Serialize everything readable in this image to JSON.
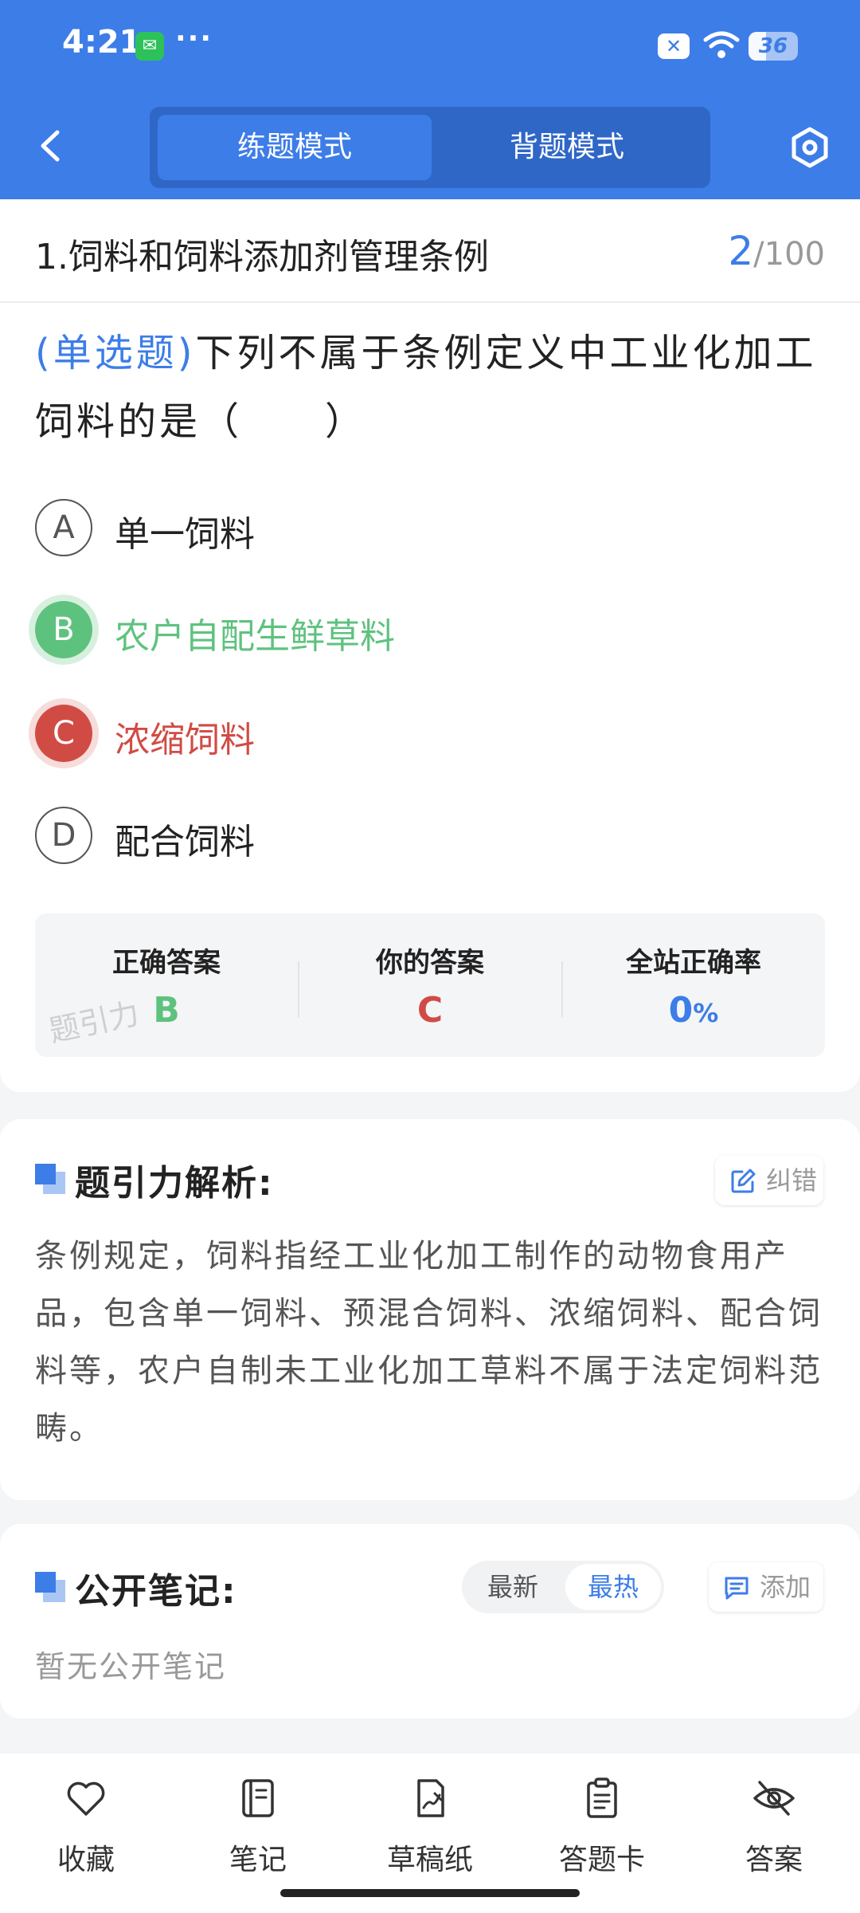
{
  "status_bar": {
    "time": "4:21",
    "dots": "···",
    "battery": "36",
    "battery_level": 0.36
  },
  "header": {
    "tabs": [
      {
        "label": "练题模式",
        "active": true
      },
      {
        "label": "背题模式",
        "active": false
      }
    ],
    "accent_color": "#3d7de8"
  },
  "question": {
    "chapter": "1.饲料和饲料添加剂管理条例",
    "current": "2",
    "total": "/100",
    "type": "(单选题)",
    "text": "下列不属于条例定义中工业化加工饲料的是（　　）",
    "options": [
      {
        "letter": "A",
        "text": "单一饲料",
        "state": "normal"
      },
      {
        "letter": "B",
        "text": "农户自配生鲜草料",
        "state": "correct"
      },
      {
        "letter": "C",
        "text": "浓缩饲料",
        "state": "wrong"
      },
      {
        "letter": "D",
        "text": "配合饲料",
        "state": "normal"
      }
    ]
  },
  "answer_summary": {
    "correct_label": "正确答案",
    "correct_value": "B",
    "yours_label": "你的答案",
    "yours_value": "C",
    "rate_label": "全站正确率",
    "rate_value": "0",
    "rate_unit": "%",
    "watermark": "题引力",
    "correct_color": "#5ec27f",
    "wrong_color": "#d14b45"
  },
  "analysis": {
    "title": "题引力解析:",
    "report_button": "纠错",
    "text": "条例规定，饲料指经工业化加工制作的动物食用产品，包含单一饲料、预混合饲料、浓缩饲料、配合饲料等，农户自制未工业化加工草料不属于法定饲料范畴。"
  },
  "notes": {
    "title": "公开笔记:",
    "sort_latest": "最新",
    "sort_hottest": "最热",
    "add_button": "添加",
    "empty_text": "暂无公开笔记"
  },
  "bottom_bar": {
    "items": [
      {
        "label": "收藏",
        "icon": "heart-icon"
      },
      {
        "label": "笔记",
        "icon": "notebook-icon"
      },
      {
        "label": "草稿纸",
        "icon": "draft-paper-icon"
      },
      {
        "label": "答题卡",
        "icon": "answer-sheet-icon"
      },
      {
        "label": "答案",
        "icon": "eye-off-icon"
      }
    ]
  }
}
